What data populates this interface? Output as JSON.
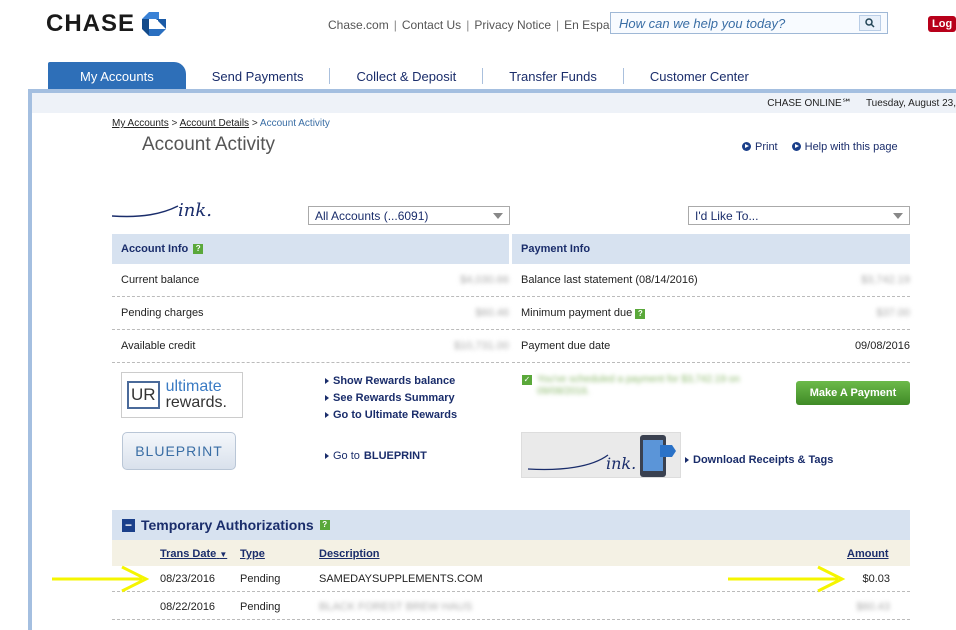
{
  "brand": {
    "name": "CHASE"
  },
  "toplinks": [
    "Chase.com",
    "Contact Us",
    "Privacy Notice",
    "En Español"
  ],
  "search": {
    "placeholder": "How can we help you today?"
  },
  "logout": "Log",
  "nav": {
    "tabs": [
      "My Accounts",
      "Send Payments",
      "Collect & Deposit",
      "Transfer Funds",
      "Customer Center"
    ],
    "active": 0
  },
  "status": {
    "label": "CHASE ONLINE℠",
    "date": "Tuesday, August 23,"
  },
  "breadcrumb": [
    "My Accounts",
    "Account Details",
    "Account Activity"
  ],
  "page": {
    "title": "Account Activity",
    "print": "Print",
    "help": "Help with this page"
  },
  "selects": {
    "accounts": "All Accounts (...6091)",
    "actions": "I'd Like To..."
  },
  "account_info": {
    "title": "Account Info",
    "rows": [
      {
        "label": "Current balance",
        "value": "$4,030.66"
      },
      {
        "label": "Pending charges",
        "value": "$60.46"
      },
      {
        "label": "Available credit",
        "value": "$10,731.00"
      }
    ]
  },
  "payment_info": {
    "title": "Payment Info",
    "rows": [
      {
        "label": "Balance last statement (08/14/2016)",
        "value": "$3,742.19"
      },
      {
        "label": "Minimum payment due",
        "value": "$37.00"
      },
      {
        "label": "Payment due date",
        "value": "09/08/2016"
      }
    ]
  },
  "rewards": {
    "ur_logo": "UR",
    "ur_text1": "ultimate",
    "ur_text2": "rewards.",
    "links": [
      "Show Rewards balance",
      "See Rewards Summary",
      "Go to Ultimate Rewards"
    ]
  },
  "blueprint": {
    "logo": "BLUEPRINT",
    "link_prefix": "Go to ",
    "link_bold": "BLUEPRINT"
  },
  "payment": {
    "scheduled": "You've scheduled a payment for $3,742.19 on 09/08/2016.",
    "button": "Make A Payment",
    "download": "Download Receipts & Tags"
  },
  "ink": "ink.",
  "temp_auth": {
    "title": "Temporary Authorizations",
    "columns": [
      "Trans Date",
      "Type",
      "Description",
      "Amount"
    ],
    "rows": [
      {
        "date": "08/23/2016",
        "type": "Pending",
        "desc": "SAMEDAYSUPPLEMENTS.COM",
        "amount": "$0.03"
      },
      {
        "date": "08/22/2016",
        "type": "Pending",
        "desc": "BLACK FOREST BREW HAUS",
        "amount": "$60.43"
      }
    ]
  },
  "colors": {
    "nav_active": "#2e6fb8",
    "navy": "#1a2d6b",
    "panel": "#d7e2f0",
    "green": "#4f9a30",
    "arrow": "#f5f500"
  }
}
